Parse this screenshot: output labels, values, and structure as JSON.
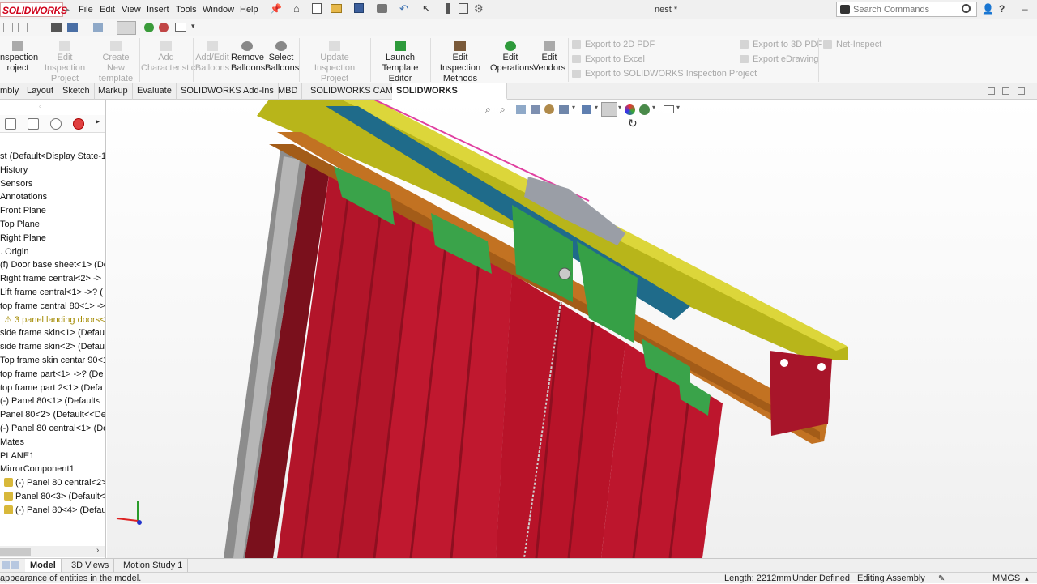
{
  "app": {
    "logo_text": "SOLIDWORKS",
    "document_title": "nest *",
    "menu": [
      "File",
      "Edit",
      "View",
      "Insert",
      "Tools",
      "Window",
      "Help"
    ],
    "search_placeholder": "Search Commands",
    "accent_color": "#d0021b"
  },
  "ribbon": {
    "buttons": [
      {
        "label_1": "nspection",
        "label_2": "roject",
        "enabled": true
      },
      {
        "label_1": "Edit Inspection",
        "label_2": "Project",
        "enabled": false
      },
      {
        "label_1": "Create New",
        "label_2": "template",
        "enabled": false
      },
      {
        "label_1": "Add",
        "label_2": "Characteristic",
        "enabled": false
      },
      {
        "label_1": "Add/Edit",
        "label_2": "Balloons",
        "enabled": false
      },
      {
        "label_1": "Remove",
        "label_2": "Balloons",
        "enabled": true
      },
      {
        "label_1": "Select",
        "label_2": "Balloons",
        "enabled": true
      },
      {
        "label_1": "Update Inspection",
        "label_2": "Project",
        "enabled": false
      },
      {
        "label_1": "Launch",
        "label_2": "Template Editor",
        "enabled": true
      },
      {
        "label_1": "Edit Inspection",
        "label_2": "Methods",
        "enabled": true
      },
      {
        "label_1": "Edit",
        "label_2": "Operations",
        "enabled": true
      },
      {
        "label_1": "Edit",
        "label_2": "Vendors",
        "enabled": true
      }
    ],
    "export_items": [
      "Export to 2D PDF",
      "Export to Excel",
      "Export to SOLIDWORKS Inspection Project"
    ],
    "export_items_2": [
      "Export to 3D PDF",
      "Export eDrawing"
    ],
    "net_inspect": "Net-Inspect"
  },
  "tabs": [
    "mbly",
    "Layout",
    "Sketch",
    "Markup",
    "Evaluate",
    "SOLIDWORKS Add-Ins",
    "MBD",
    "SOLIDWORKS CAM",
    "SOLIDWORKS Inspection"
  ],
  "active_tab": "SOLIDWORKS Inspection",
  "tree": [
    {
      "label": "st  (Default<Display State-1",
      "icon": "assembly"
    },
    {
      "label": "History",
      "icon": "history"
    },
    {
      "label": "Sensors",
      "icon": "sensor"
    },
    {
      "label": "Annotations",
      "icon": "annotation"
    },
    {
      "label": "Front Plane",
      "icon": "plane"
    },
    {
      "label": "Top Plane",
      "icon": "plane"
    },
    {
      "label": "Right Plane",
      "icon": "plane"
    },
    {
      "label": ". Origin",
      "icon": "origin"
    },
    {
      "label": "(f) Door base sheet<1> (De",
      "icon": "part"
    },
    {
      "label": "Right frame central<2> ->",
      "icon": "part"
    },
    {
      "label": "Lift frame central<1> ->? (",
      "icon": "part"
    },
    {
      "label": "top frame central 80<1> ->",
      "icon": "part"
    },
    {
      "label": "⚠ 3 panel landing doors<",
      "icon": "warning",
      "yellow": true
    },
    {
      "label": "side frame skin<1> (Defau",
      "icon": "part"
    },
    {
      "label": "side frame skin<2> (Defaul",
      "icon": "part"
    },
    {
      "label": "Top frame skin centar 90<1",
      "icon": "part"
    },
    {
      "label": "top frame part<1> ->? (De",
      "icon": "part"
    },
    {
      "label": "top frame part 2<1> (Defa",
      "icon": "part"
    },
    {
      "label": "(-) Panel 80<1> (Default<",
      "icon": "part"
    },
    {
      "label": "Panel 80<2> (Default<<De",
      "icon": "part"
    },
    {
      "label": "(-) Panel 80 central<1> (De",
      "icon": "part"
    },
    {
      "label": "Mates",
      "icon": "mates"
    },
    {
      "label": "PLANE1",
      "icon": "plane"
    },
    {
      "label": "MirrorComponent1",
      "icon": "mirror"
    },
    {
      "label": "(-) Panel 80 central<2>",
      "icon": "subpart"
    },
    {
      "label": "Panel 80<3> (Default<",
      "icon": "subpart"
    },
    {
      "label": "(-) Panel 80<4> (Defaul",
      "icon": "subpart"
    }
  ],
  "bottom_tabs": [
    "Model",
    "3D Views",
    "Motion Study 1"
  ],
  "active_bottom_tab": "Model",
  "status": {
    "left": "appearance of entities in the model.",
    "length": "Length: 2212mm",
    "state": "Under Defined",
    "mode": "Editing Assembly",
    "units": "MMGS"
  }
}
